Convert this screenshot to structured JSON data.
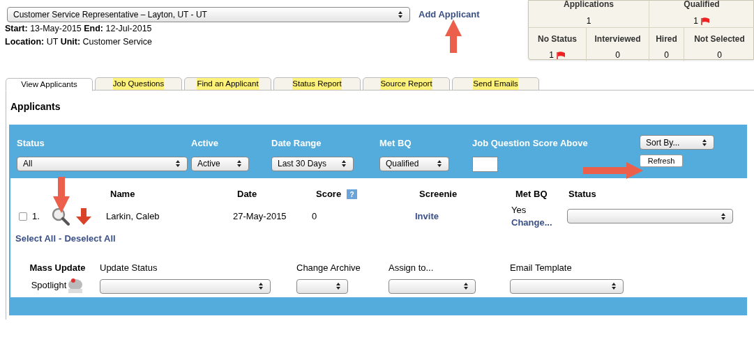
{
  "job_select": {
    "value": "Customer Service Representative – Layton, UT - UT"
  },
  "add_applicant": "Add Applicant",
  "info_lines": [
    "**Start:** 13-May-2015 **End:** 12-Jul-2015",
    "**Location:** UT **Unit:** Customer Service"
  ],
  "stats": {
    "top": [
      {
        "label": "Applications",
        "value": "1",
        "flagged": false
      },
      {
        "label": "Qualified",
        "value": "1",
        "flagged": true
      }
    ],
    "bottom": [
      {
        "label": "No Status",
        "value": "1",
        "flagged": true
      },
      {
        "label": "Interviewed",
        "value": "0",
        "flagged": false
      },
      {
        "label": "Hired",
        "value": "0",
        "flagged": false
      },
      {
        "label": "Not Selected",
        "value": "0",
        "flagged": false
      }
    ]
  },
  "tabs": [
    {
      "label": "View Applicants",
      "selected": true
    },
    {
      "label": "Job Questions",
      "selected": false
    },
    {
      "label": "Find an Applicant",
      "selected": false
    },
    {
      "label": "Status Report",
      "selected": false
    },
    {
      "label": "Source Report",
      "selected": false
    },
    {
      "label": "Send Emails",
      "selected": false
    }
  ],
  "section_title": "Applicants",
  "filters": [
    {
      "label": "Status",
      "kind": "select",
      "value": "All"
    },
    {
      "label": "Active",
      "kind": "select",
      "value": "Active"
    },
    {
      "label": "Date Range",
      "kind": "select",
      "value": "Last 30 Days"
    },
    {
      "label": "Met BQ",
      "kind": "select",
      "value": "Qualified"
    },
    {
      "label": "Job Question Score Above",
      "kind": "input"
    }
  ],
  "sort_select": {
    "value": "Sort By..."
  },
  "refresh_button": "Refresh",
  "score_help": "?",
  "table": {
    "columns": [
      "Name",
      "Date",
      "Score",
      "Screenie",
      "Met BQ",
      "Status"
    ],
    "rows": [
      {
        "checked": false,
        "index": "1.",
        "name": "Larkin, Caleb",
        "date": "27-May-2015",
        "score": "0",
        "screenie": "Invite",
        "met_bq": "Yes",
        "change": "Change..."
      }
    ]
  },
  "select_all": "Select All",
  "deselect_all": "Deselect All",
  "separator": "-",
  "mass_update": {
    "title": "Mass Update",
    "spotlight": "Spotlight",
    "fields": [
      "Update Status",
      "Change Archive",
      "Assign to...",
      "Email Template"
    ]
  }
}
